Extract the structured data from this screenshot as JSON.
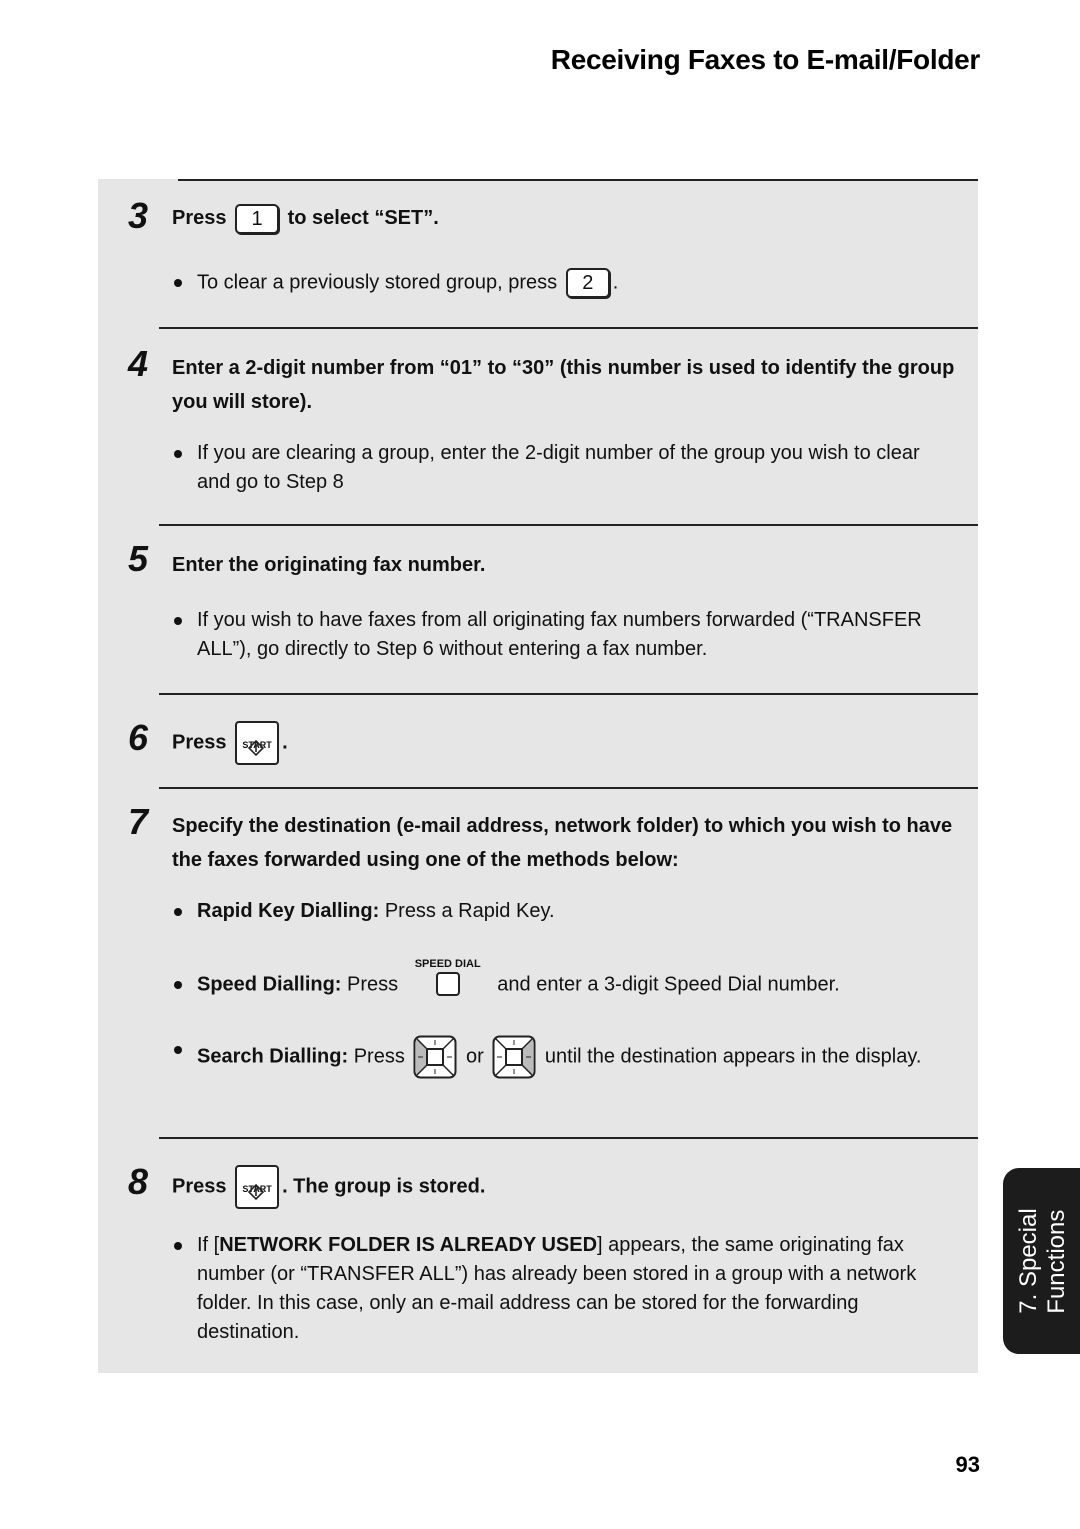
{
  "header": {
    "title": "Receiving Faxes to E-mail/Folder"
  },
  "steps": {
    "s3": {
      "num": "3",
      "head_pre": "Press",
      "key": "1",
      "head_post": "to select “SET”.",
      "bullet_pre": "To clear a previously stored group, press",
      "bullet_key": "2",
      "bullet_post": "."
    },
    "s4": {
      "num": "4",
      "head": "Enter a 2-digit number from “01” to “30” (this number is used to identify the group you will store).",
      "bullet": "If you are clearing a group, enter the 2-digit number of the group you wish to clear and go to Step 8"
    },
    "s5": {
      "num": "5",
      "head": "Enter the originating fax number.",
      "bullet": "If you wish to have faxes from all originating fax numbers forwarded (“TRANSFER ALL”), go directly to Step 6 without entering a fax number."
    },
    "s6": {
      "num": "6",
      "head_pre": "Press",
      "key_label": "START",
      "head_post": "."
    },
    "s7": {
      "num": "7",
      "head": "Specify the destination (e-mail address, network folder) to which you wish to have the faxes forwarded using one of the methods below:",
      "rapid_label": "Rapid Key Dialling:",
      "rapid_text": "Press a Rapid Key.",
      "speed_label": "Speed Dialling:",
      "speed_pre": "Press",
      "speed_key_label": "SPEED DIAL",
      "speed_post": "and enter a 3-digit Speed Dial number.",
      "search_label": "Search Dialling:",
      "search_pre": "Press",
      "search_or": "or",
      "search_post": "until the destination appears in the display."
    },
    "s8": {
      "num": "8",
      "head_pre": "Press",
      "key_label": "START",
      "head_post": ". The group is stored.",
      "bullet_pre": "If [",
      "bullet_bold": "NETWORK FOLDER IS ALREADY USED",
      "bullet_post": "] appears, the same originating fax number (or “TRANSFER ALL”) has already been stored in a group with a network folder. In this case, only an e-mail address can be stored for the forwarding destination."
    }
  },
  "side_tab": {
    "line1": "7. Special",
    "line2": "Functions"
  },
  "footer": {
    "page_number": "93"
  }
}
